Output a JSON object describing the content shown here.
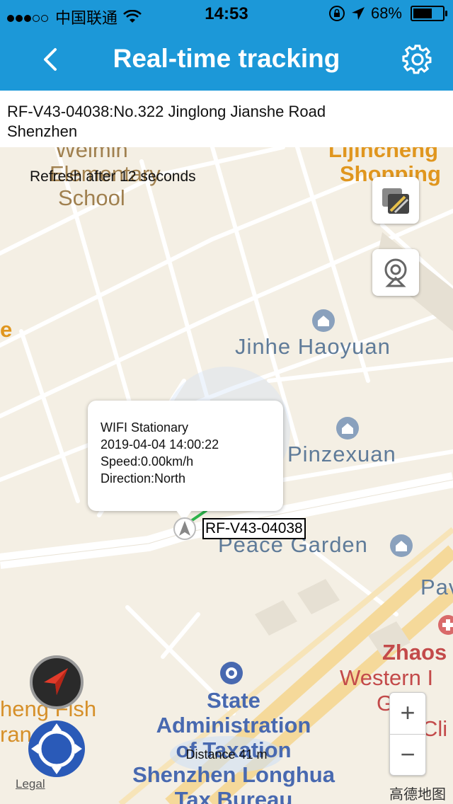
{
  "status_bar": {
    "carrier": "中国联通",
    "time": "14:53",
    "battery": "68%",
    "battery_level": 0.68
  },
  "nav": {
    "title": "Real-time tracking",
    "back_icon": "chevron-left-icon",
    "settings_icon": "gear-icon"
  },
  "address": {
    "line1": "RF-V43-04038:No.322 Jinglong Jianshe Road",
    "line2": "Shenzhen"
  },
  "map": {
    "refresh_text": "Refresh after 12 seconds",
    "labels": {
      "weimin": "Weimin",
      "elementary": "Elementary",
      "school": "School",
      "lijincheng": "Lijincheng",
      "shopping": "Shopping",
      "jinhe": "Jinhe Haoyuan",
      "pinzexuan": "Pinzexuan",
      "peace_garden": "Peace Garden",
      "pav": "Pav",
      "zhaos": "Zhaos",
      "western": "Western I",
      "gec": "G   ec",
      "cli": "Cli",
      "eng_fish": "heng Fish",
      "ran": "ran",
      "gov1": "State",
      "gov2": "Administration",
      "gov3": "of Taxation",
      "gov4": "Shenzhen Longhua",
      "gov5": "Tax Bureau",
      "edge_e": "e"
    },
    "popup": {
      "status": "WIFI Stationary",
      "datetime": "2019-04-04 14:00:22",
      "speed": "Speed:0.00km/h",
      "direction": "Direction:North"
    },
    "device_label": "RF-V43-04038",
    "distance": "Distance 41 m",
    "legal": "Legal",
    "zoom_in": "+",
    "zoom_out": "−",
    "provider": "高德地图",
    "colors": {
      "nav_bar": "#1c98d8",
      "map_bg": "#f4efe4",
      "road": "#ffffff",
      "track": "#2db34a"
    }
  }
}
